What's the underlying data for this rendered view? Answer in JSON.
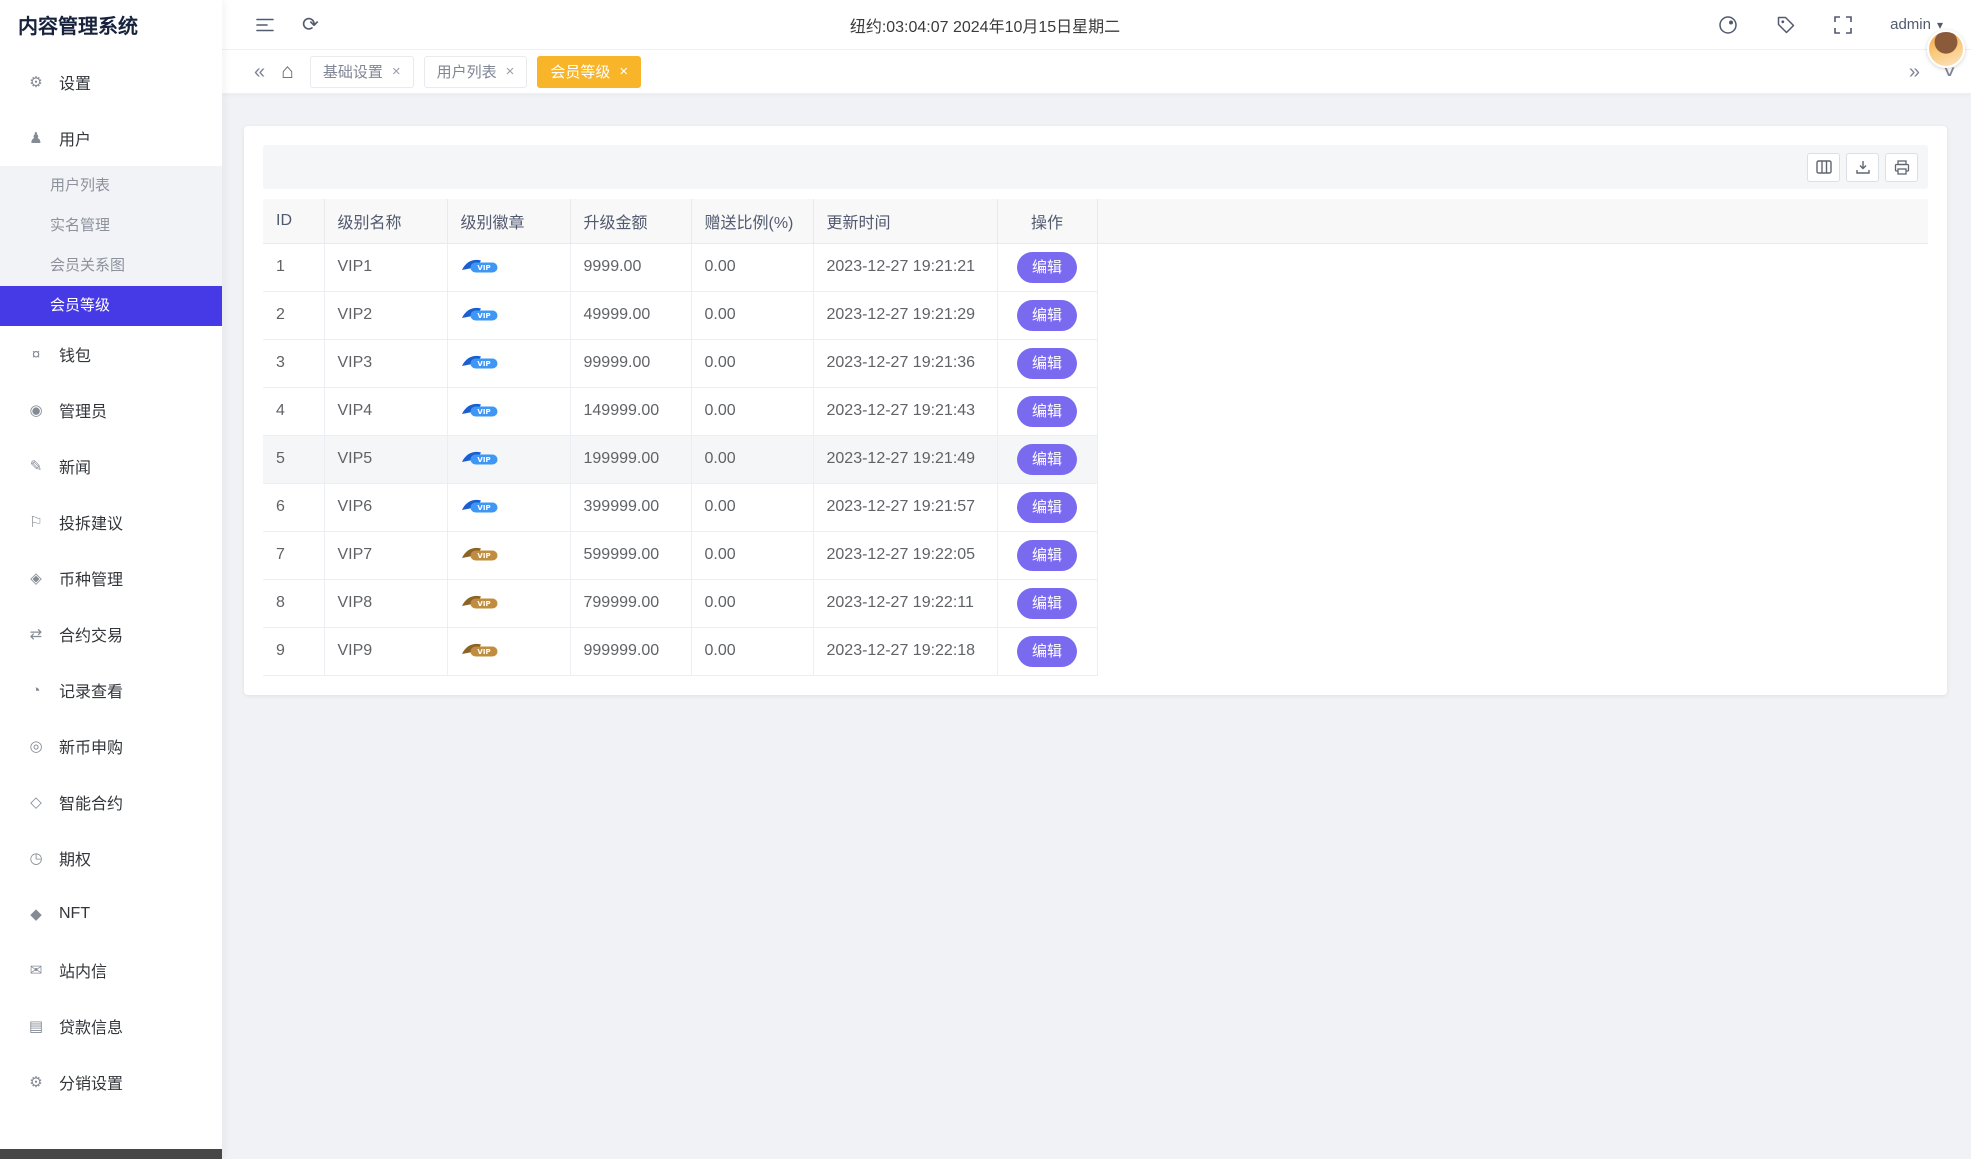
{
  "app": {
    "title": "内容管理系统"
  },
  "header": {
    "time_text": "纽约:03:04:07 2024年10月15日星期二",
    "user_label": "admin",
    "icons": [
      "menu-fold",
      "refresh",
      "theme",
      "tag",
      "fullscreen",
      "caret-down",
      "avatar"
    ]
  },
  "tabs": {
    "icons": [
      "scroll-left",
      "home",
      "scroll-right",
      "tabs-menu"
    ],
    "items": [
      {
        "key": "basic-settings",
        "label": "基础设置",
        "closable": true,
        "active": false
      },
      {
        "key": "user-list",
        "label": "用户列表",
        "closable": true,
        "active": false
      },
      {
        "key": "member-level",
        "label": "会员等级",
        "closable": true,
        "active": true
      }
    ]
  },
  "sidebar": {
    "items": [
      {
        "key": "settings",
        "label": "设置",
        "icon": "gear"
      },
      {
        "key": "users",
        "label": "用户",
        "icon": "user",
        "expanded": true,
        "children": [
          {
            "key": "user-list",
            "label": "用户列表",
            "active": false
          },
          {
            "key": "realname-manage",
            "label": "实名管理",
            "active": false
          },
          {
            "key": "member-relation-graph",
            "label": "会员关系图",
            "active": false
          },
          {
            "key": "member-level",
            "label": "会员等级",
            "active": true
          }
        ]
      },
      {
        "key": "wallet",
        "label": "钱包",
        "icon": "wallet"
      },
      {
        "key": "administrators",
        "label": "管理员",
        "icon": "shield"
      },
      {
        "key": "news",
        "label": "新闻",
        "icon": "pencil"
      },
      {
        "key": "feedback",
        "label": "投拆建议",
        "icon": "flag"
      },
      {
        "key": "currency-manage",
        "label": "币种管理",
        "icon": "diamond-dot"
      },
      {
        "key": "contract-trade",
        "label": "合约交易",
        "icon": "exchange"
      },
      {
        "key": "records-view",
        "label": "记录查看",
        "icon": "clock"
      },
      {
        "key": "new-coin-subscribe",
        "label": "新币申购",
        "icon": "coin"
      },
      {
        "key": "smart-contract",
        "label": "智能合约",
        "icon": "diamond-outline"
      },
      {
        "key": "options",
        "label": "期权",
        "icon": "pie"
      },
      {
        "key": "nft",
        "label": "NFT",
        "icon": "diamond"
      },
      {
        "key": "site-messages",
        "label": "站内信",
        "icon": "mail"
      },
      {
        "key": "loan-info",
        "label": "贷款信息",
        "icon": "document"
      },
      {
        "key": "distribution-settings",
        "label": "分销设置",
        "icon": "gear"
      }
    ]
  },
  "toolbar": {
    "icons": [
      "columns",
      "export",
      "print"
    ]
  },
  "table": {
    "columns": [
      "ID",
      "级别名称",
      "级别徽章",
      "升级金额",
      "赠送比例(%)",
      "更新时间",
      "操作"
    ],
    "edit_label": "编辑",
    "badge_text": "VIP",
    "rows": [
      {
        "id": "1",
        "name": "VIP1",
        "badge": "blue",
        "amount": "9999.00",
        "ratio": "0.00",
        "updated": "2023-12-27 19:21:21",
        "highlight": false
      },
      {
        "id": "2",
        "name": "VIP2",
        "badge": "blue",
        "amount": "49999.00",
        "ratio": "0.00",
        "updated": "2023-12-27 19:21:29",
        "highlight": false
      },
      {
        "id": "3",
        "name": "VIP3",
        "badge": "blue",
        "amount": "99999.00",
        "ratio": "0.00",
        "updated": "2023-12-27 19:21:36",
        "highlight": false
      },
      {
        "id": "4",
        "name": "VIP4",
        "badge": "blue",
        "amount": "149999.00",
        "ratio": "0.00",
        "updated": "2023-12-27 19:21:43",
        "highlight": false
      },
      {
        "id": "5",
        "name": "VIP5",
        "badge": "blue",
        "amount": "199999.00",
        "ratio": "0.00",
        "updated": "2023-12-27 19:21:49",
        "highlight": true
      },
      {
        "id": "6",
        "name": "VIP6",
        "badge": "blue",
        "amount": "399999.00",
        "ratio": "0.00",
        "updated": "2023-12-27 19:21:57",
        "highlight": false
      },
      {
        "id": "7",
        "name": "VIP7",
        "badge": "gold",
        "amount": "599999.00",
        "ratio": "0.00",
        "updated": "2023-12-27 19:22:05",
        "highlight": false
      },
      {
        "id": "8",
        "name": "VIP8",
        "badge": "gold",
        "amount": "799999.00",
        "ratio": "0.00",
        "updated": "2023-12-27 19:22:11",
        "highlight": false
      },
      {
        "id": "9",
        "name": "VIP9",
        "badge": "gold",
        "amount": "999999.00",
        "ratio": "0.00",
        "updated": "2023-12-27 19:22:18",
        "highlight": false
      }
    ]
  },
  "colors": {
    "sidebar_active": "#4639e6",
    "accent_yellow": "#f8b52a",
    "edit_button": "#7a6af0",
    "badge_blue": "#3f97f5",
    "badge_gold": "#c08c3e",
    "page_bg": "#f0f2f5"
  }
}
